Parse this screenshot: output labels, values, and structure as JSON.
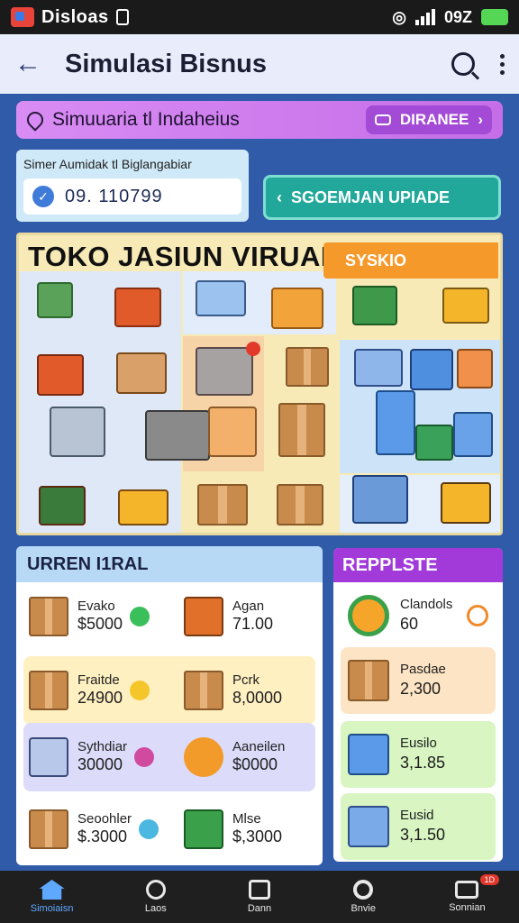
{
  "status_bar": {
    "app_label": "Disloas",
    "time": "09Z",
    "battery_color": "#55d655"
  },
  "header": {
    "title": "Simulasi Bisnus",
    "back_icon": "arrow-left-icon",
    "search_icon": "search-icon",
    "menu_icon": "kebab-menu-icon"
  },
  "banner": {
    "text": "Simuuaria tl Indaheius",
    "button_label": "DIRANEE",
    "bg_color": "#c56ee8"
  },
  "stats": {
    "label": "Simer Aumidak tl Biglangabiar",
    "value": "09. 110799"
  },
  "upgrade_button": {
    "label": "SGOEMJAN UPIADE",
    "color": "#22a89a"
  },
  "store": {
    "title": "TOKO JASIUN VIRUAL",
    "badge": "SYSKIO",
    "badge_color": "#f59a2a"
  },
  "inventory": {
    "title": "URREN I1RAL",
    "rows": [
      {
        "items": [
          {
            "name": "Evako",
            "price": "$5000",
            "icon": "bag-icon"
          },
          {
            "name": "Agan",
            "price": "71.00",
            "icon": "crate-icon"
          }
        ]
      },
      {
        "items": [
          {
            "name": "Fraitde",
            "price": "24900",
            "icon": "bag-icon"
          },
          {
            "name": "Pcrk",
            "price": "8,0000",
            "icon": "box-icon"
          }
        ]
      },
      {
        "items": [
          {
            "name": "Sythdiar",
            "price": "30000",
            "icon": "laptop-icon"
          },
          {
            "name": "Aaneilen",
            "price": "$0000",
            "icon": "kettle-icon"
          }
        ]
      },
      {
        "items": [
          {
            "name": "Seoohler",
            "price": "$.3000",
            "icon": "box-icon"
          },
          {
            "name": "Mlse",
            "price": "$,3000",
            "icon": "cash-icon"
          }
        ]
      }
    ]
  },
  "reports": {
    "title": "REPPLSTE",
    "rows": [
      {
        "name": "Clandols",
        "value": "60",
        "icon": "target-icon"
      },
      {
        "name": "Pasdae",
        "value": "2,300",
        "icon": "box-icon"
      },
      {
        "name": "Eusilo",
        "value": "3,1.85",
        "icon": "building-icon"
      },
      {
        "name": "Eusid",
        "value": "3,1.50",
        "icon": "shop-icon"
      }
    ]
  },
  "nav": {
    "items": [
      {
        "label": "Simoiaisn",
        "icon": "home-icon"
      },
      {
        "label": "Laos",
        "icon": "tag-icon"
      },
      {
        "label": "Dann",
        "icon": "bag-icon"
      },
      {
        "label": "Bnvie",
        "icon": "search-icon"
      },
      {
        "label": "Sonnian",
        "icon": "chat-icon",
        "badge": "1D"
      }
    ]
  }
}
